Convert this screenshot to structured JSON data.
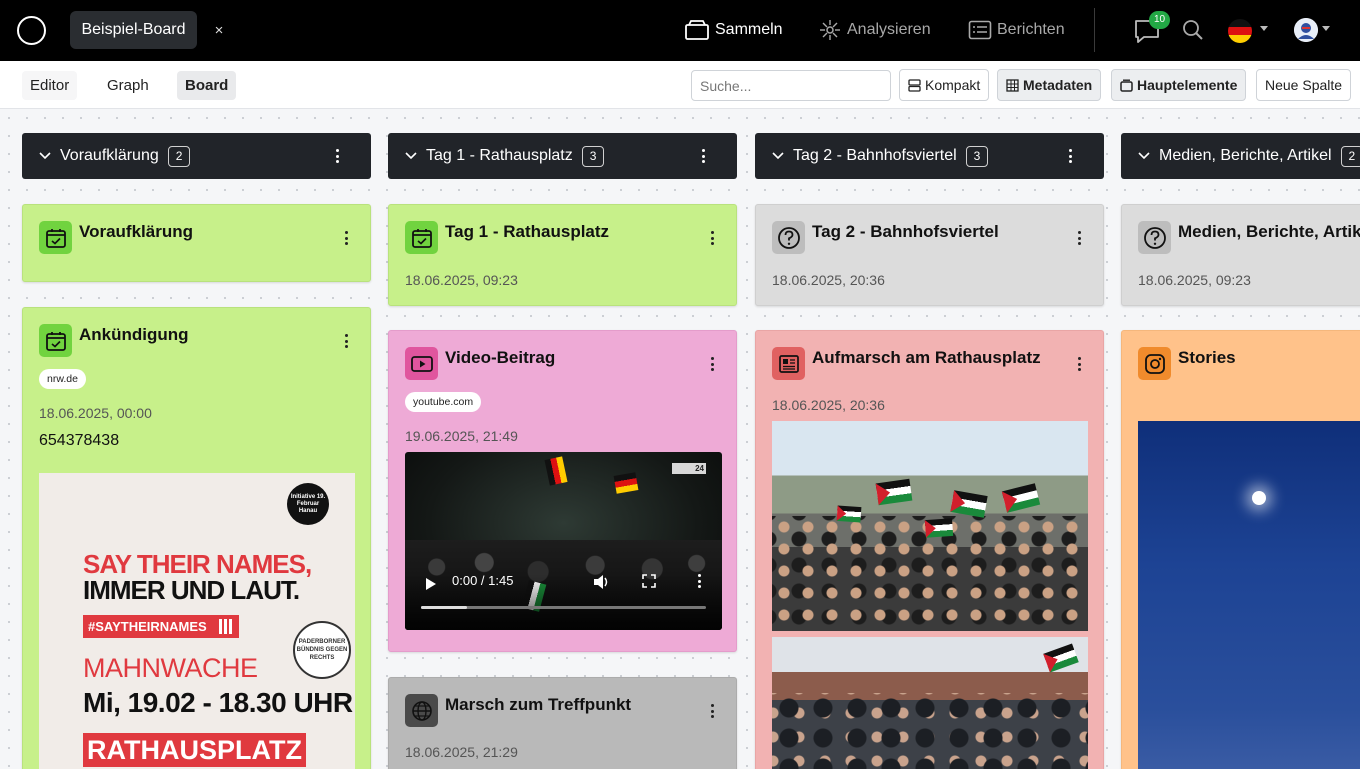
{
  "topbar": {
    "tab_label": "Beispiel-Board",
    "tab_close": "×",
    "nav": [
      {
        "label": "Sammeln",
        "icon": "collect-icon"
      },
      {
        "label": "Analysieren",
        "icon": "analyze-icon"
      },
      {
        "label": "Berichten",
        "icon": "report-icon"
      }
    ],
    "notification_count": "10"
  },
  "toolbar": {
    "view_tabs": [
      "Editor",
      "Graph",
      "Board"
    ],
    "search_placeholder": "Suche...",
    "buttons": [
      "Kompakt",
      "Metadaten",
      "Hauptelemente",
      "Neue Spalte"
    ]
  },
  "columns": [
    {
      "title": "Voraufklärung",
      "count": "2",
      "cards": [
        {
          "title": "Voraufklärung",
          "icon": "calendar-check-icon"
        },
        {
          "title": "Ankündigung",
          "icon": "calendar-check-icon",
          "source": "nrw.de",
          "date": "18.06.2025, 00:00",
          "value": "654378438",
          "poster": {
            "initiative": "Initiative 19. Februar Hanau",
            "line1": "SAY THEIR NAMES,",
            "line2": "IMMER UND LAUT.",
            "hashtag": "#SAYTHEIRNAMES",
            "seal": "PADERBORNER BÜNDNIS GEGEN RECHTS",
            "line3": "MAHNWACHE",
            "line4": "Mi, 19.02 - 18.30 UHR",
            "line5": "RATHAUSPLATZ"
          }
        }
      ]
    },
    {
      "title": "Tag 1 - Rathausplatz",
      "count": "3",
      "cards": [
        {
          "title": "Tag 1 - Rathausplatz",
          "icon": "calendar-check-icon",
          "date": "18.06.2025, 09:23"
        },
        {
          "title": "Video-Beitrag",
          "icon": "youtube-icon",
          "source": "youtube.com",
          "date": "19.06.2025, 21:49",
          "video": {
            "time": "0:00 / 1:45",
            "channel_logo": "24",
            "progress": 0.16
          }
        },
        {
          "title": "Marsch zum Treffpunkt",
          "icon": "globe-icon",
          "date": "18.06.2025, 21:29"
        }
      ]
    },
    {
      "title": "Tag 2 - Bahnhofsviertel",
      "count": "3",
      "cards": [
        {
          "title": "Tag 2 - Bahnhofsviertel",
          "icon": "question-icon",
          "date": "18.06.2025, 20:36"
        },
        {
          "title": "Aufmarsch am Rathausplatz",
          "icon": "newspaper-icon",
          "date": "18.06.2025, 20:36"
        }
      ]
    },
    {
      "title": "Medien, Berichte, Artikel",
      "count": "2",
      "cards": [
        {
          "title": "Medien, Berichte, Artikel",
          "icon": "question-icon",
          "date": "18.06.2025, 09:23"
        },
        {
          "title": "Stories",
          "icon": "instagram-icon"
        }
      ]
    }
  ],
  "colors": {
    "green": "#c7f08a",
    "gray": "#dcdcdc",
    "pink": "#eeaad6",
    "salmon": "#f2b2b2",
    "peach": "#ffc28a",
    "header": "#212429"
  }
}
